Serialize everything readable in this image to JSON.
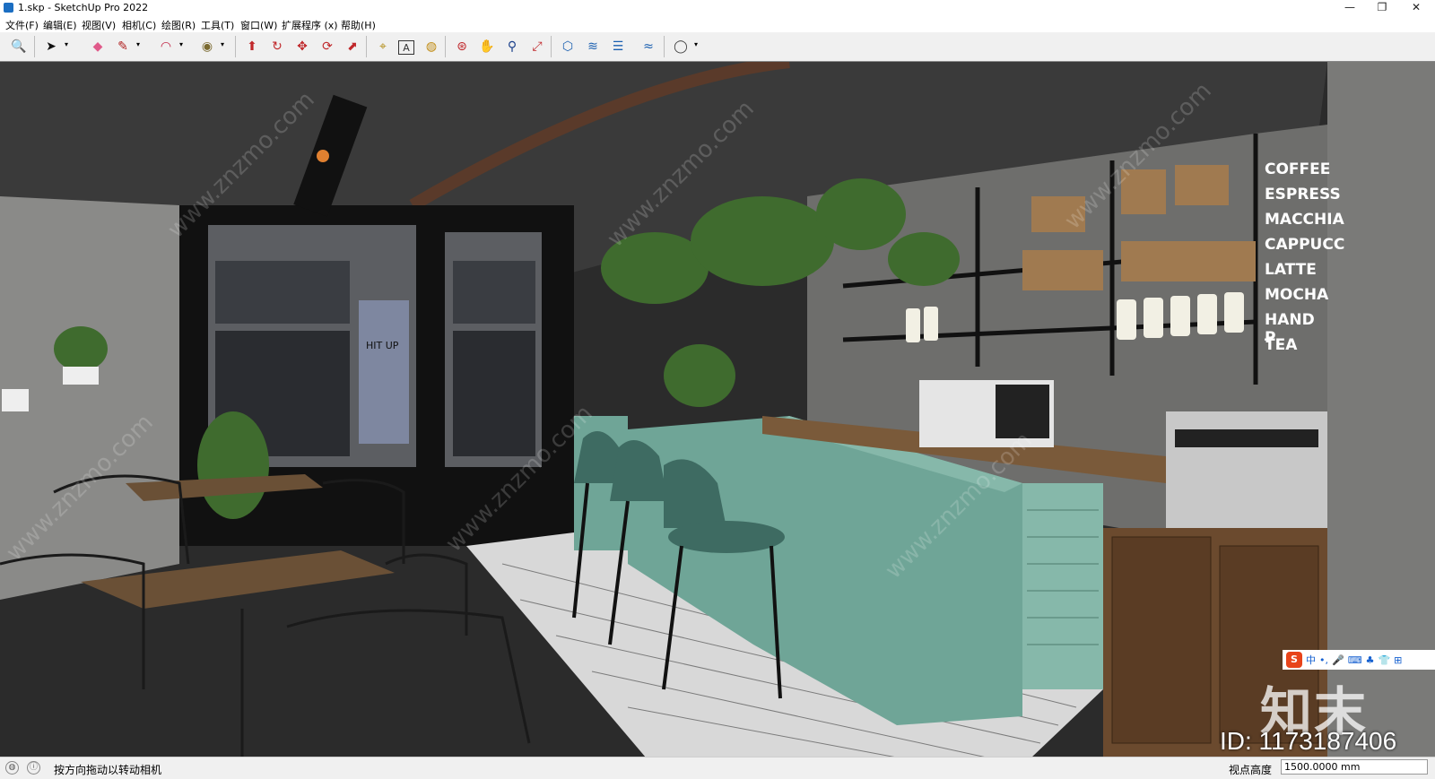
{
  "window": {
    "title": "1.skp - SketchUp Pro 2022",
    "minimize_symbol": "—",
    "maximize_symbol": "❐",
    "close_symbol": "✕"
  },
  "menu": [
    "文件(F)",
    "编辑(E)",
    "视图(V)",
    "相机(C)",
    "绘图(R)",
    "工具(T)",
    "窗口(W)",
    "扩展程序 (x)",
    "帮助(H)"
  ],
  "toolbar": {
    "tools": [
      {
        "name": "zoom-extents-icon",
        "glyph": "🔍"
      },
      {
        "name": "select-icon",
        "glyph": "➤"
      },
      {
        "name": "eraser-icon",
        "glyph": "◆"
      },
      {
        "name": "pencil-icon",
        "glyph": "✎"
      },
      {
        "name": "arc-icon",
        "glyph": "◠"
      },
      {
        "name": "shape-icon",
        "glyph": "◉"
      },
      {
        "name": "push-pull-icon",
        "glyph": "⬆"
      },
      {
        "name": "follow-me-icon",
        "glyph": "↻"
      },
      {
        "name": "move-icon",
        "glyph": "✥"
      },
      {
        "name": "rotate-icon",
        "glyph": "⟳"
      },
      {
        "name": "scale-icon",
        "glyph": "⬈"
      },
      {
        "name": "tape-measure-icon",
        "glyph": "⌖"
      },
      {
        "name": "text-icon",
        "glyph": "A"
      },
      {
        "name": "paint-bucket-icon",
        "glyph": "◍"
      },
      {
        "name": "orbit-icon",
        "glyph": "⊛"
      },
      {
        "name": "pan-icon",
        "glyph": "✋"
      },
      {
        "name": "zoom-icon",
        "glyph": "⚲"
      },
      {
        "name": "zoom-window-icon",
        "glyph": "⤢"
      },
      {
        "name": "warehouse-icon",
        "glyph": "⬡"
      },
      {
        "name": "extension-icon",
        "glyph": "≋"
      },
      {
        "name": "layers-icon",
        "glyph": "☰"
      },
      {
        "name": "sandbox-icon",
        "glyph": "≈"
      },
      {
        "name": "account-icon",
        "glyph": "◯"
      }
    ],
    "dropdown_symbol": "▾"
  },
  "scene": {
    "menu_board": [
      "COFFEE",
      "ESPRESS",
      "MACCHIA",
      "CAPPUCC",
      "LATTE",
      "MOCHA",
      "HAND P",
      "TEA"
    ],
    "door_sign": "HIT UP",
    "watermark_text": "www.znzmo.com"
  },
  "overlay": {
    "ime_items": [
      "S",
      "中",
      "•,",
      "🎤",
      "⌨",
      "♣",
      "👕",
      "⊞"
    ],
    "brand": "知末",
    "asset_id": "ID: 1173187406"
  },
  "status": {
    "hint": "按方向拖动以转动相机",
    "measure_label": "视点高度",
    "measure_value": "1500.0000 mm",
    "icon_geo": "◍",
    "icon_info": "ⓘ"
  }
}
